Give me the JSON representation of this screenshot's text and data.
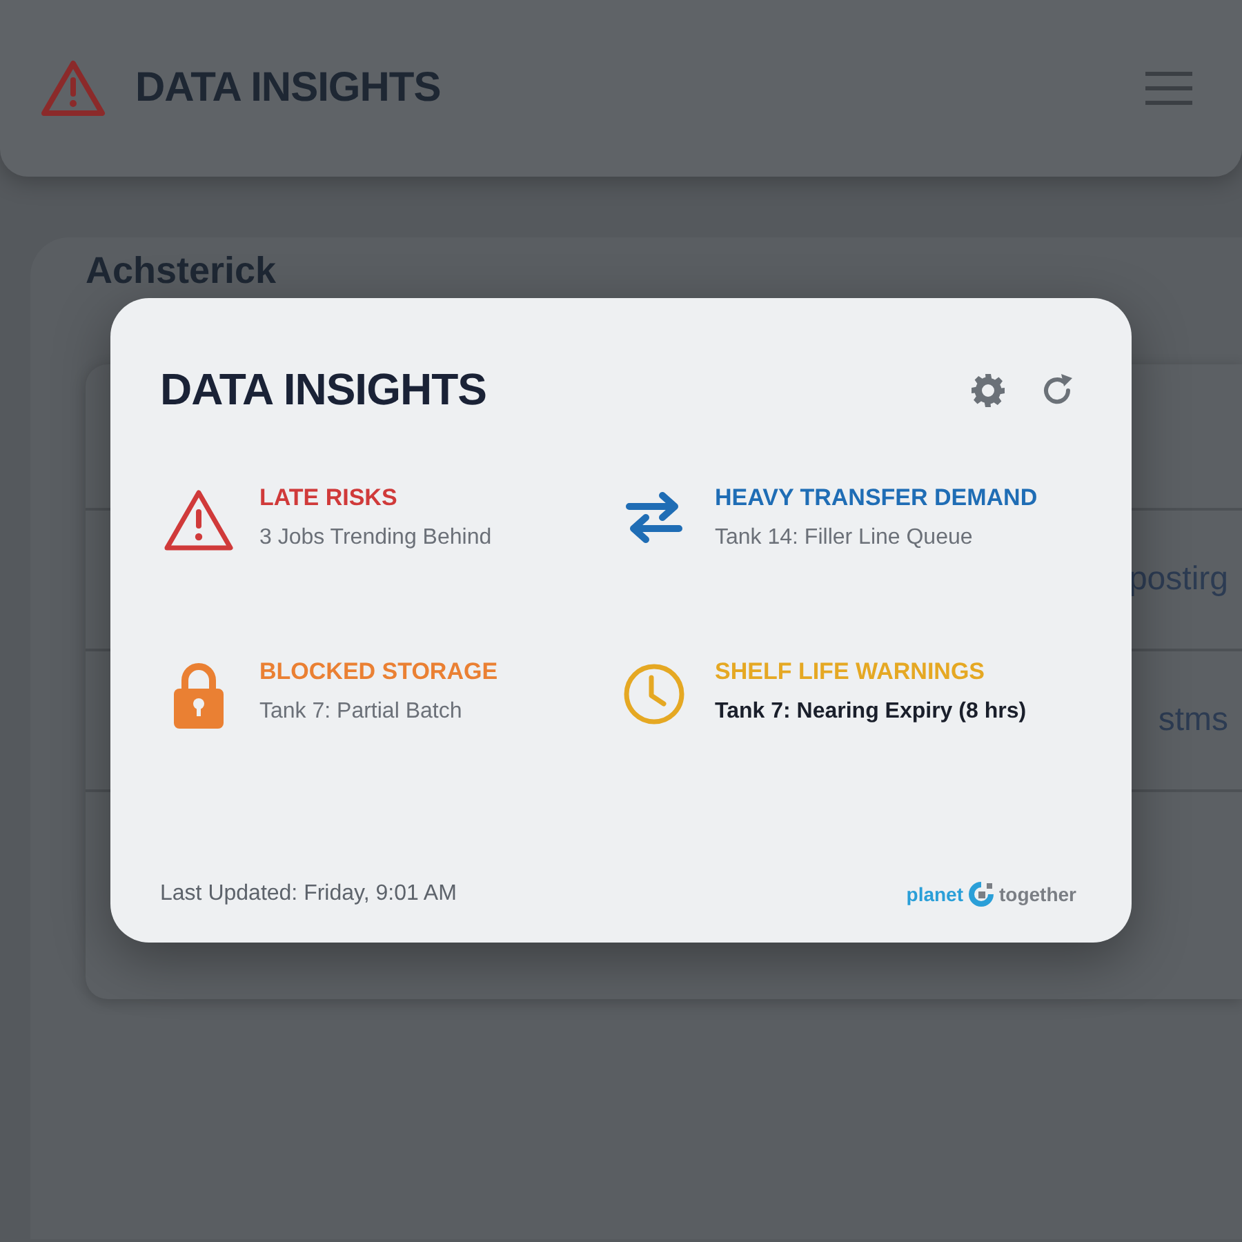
{
  "header": {
    "title": "DATA INSIGHTS"
  },
  "background_card": {
    "title": "Achsterick",
    "rows": [
      "postirg",
      "stms"
    ]
  },
  "dialog": {
    "title": "DATA INSIGHTS",
    "insights": [
      {
        "kind": "warning",
        "title": "LATE RISKS",
        "detail": "3 Jobs Trending Behind",
        "color": "#d03a3a",
        "emphasized": false
      },
      {
        "kind": "transfer",
        "title": "HEAVY TRANSFER DEMAND",
        "detail": "Tank 14: Filler Line Queue",
        "color": "#1f6db5",
        "emphasized": false
      },
      {
        "kind": "lock",
        "title": "BLOCKED STORAGE",
        "detail": "Tank 7: Partial Batch",
        "color": "#ea8033",
        "emphasized": false
      },
      {
        "kind": "clock",
        "title": "SHELF LIFE WARNINGS",
        "detail": "Tank 7: Nearing Expiry (8 hrs)",
        "color": "#e5a823",
        "emphasized": true
      }
    ],
    "last_updated": "Last Updated: Friday, 9:01 AM",
    "logo": {
      "left": "planet",
      "right": "together"
    }
  }
}
